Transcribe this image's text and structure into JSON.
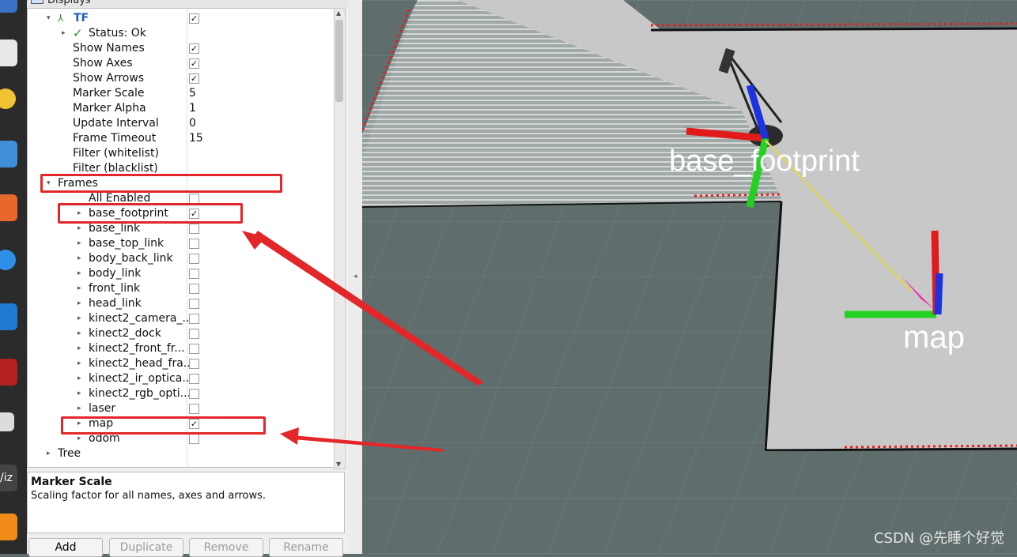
{
  "panel": {
    "title": "Displays",
    "tree": [
      {
        "label": "TF",
        "indent": 1,
        "arrow": "expanded",
        "check": true,
        "bold": true,
        "color": "#1f5fb7",
        "icon": "tf-axes-icon"
      },
      {
        "label": "Status: Ok",
        "indent": 2,
        "arrow": "collapsed",
        "icon": "checkmark-icon"
      },
      {
        "label": "Show Names",
        "indent": 2,
        "check": true
      },
      {
        "label": "Show Axes",
        "indent": 2,
        "check": true
      },
      {
        "label": "Show Arrows",
        "indent": 2,
        "check": true
      },
      {
        "label": "Marker Scale",
        "indent": 2,
        "value": "5"
      },
      {
        "label": "Marker Alpha",
        "indent": 2,
        "value": "1"
      },
      {
        "label": "Update Interval",
        "indent": 2,
        "value": "0"
      },
      {
        "label": "Frame Timeout",
        "indent": 2,
        "value": "15"
      },
      {
        "label": "Filter (whitelist)",
        "indent": 2
      },
      {
        "label": "Filter (blacklist)",
        "indent": 2
      },
      {
        "label": "Frames",
        "indent": 1,
        "arrow": "expanded"
      },
      {
        "label": "All Enabled",
        "indent": 3,
        "check": false
      },
      {
        "label": "base_footprint",
        "indent": 3,
        "arrow": "collapsed",
        "check": true
      },
      {
        "label": "base_link",
        "indent": 3,
        "arrow": "collapsed",
        "check": false
      },
      {
        "label": "base_top_link",
        "indent": 3,
        "arrow": "collapsed",
        "check": false
      },
      {
        "label": "body_back_link",
        "indent": 3,
        "arrow": "collapsed",
        "check": false
      },
      {
        "label": "body_link",
        "indent": 3,
        "arrow": "collapsed",
        "check": false
      },
      {
        "label": "front_link",
        "indent": 3,
        "arrow": "collapsed",
        "check": false
      },
      {
        "label": "head_link",
        "indent": 3,
        "arrow": "collapsed",
        "check": false
      },
      {
        "label": "kinect2_camera_...",
        "indent": 3,
        "arrow": "collapsed",
        "check": false
      },
      {
        "label": "kinect2_dock",
        "indent": 3,
        "arrow": "collapsed",
        "check": false
      },
      {
        "label": "kinect2_front_fr...",
        "indent": 3,
        "arrow": "collapsed",
        "check": false
      },
      {
        "label": "kinect2_head_fra...",
        "indent": 3,
        "arrow": "collapsed",
        "check": false
      },
      {
        "label": "kinect2_ir_optica...",
        "indent": 3,
        "arrow": "collapsed",
        "check": false
      },
      {
        "label": "kinect2_rgb_opti...",
        "indent": 3,
        "arrow": "collapsed",
        "check": false
      },
      {
        "label": "laser",
        "indent": 3,
        "arrow": "collapsed",
        "check": false
      },
      {
        "label": "map",
        "indent": 3,
        "arrow": "collapsed",
        "check": true
      },
      {
        "label": "odom",
        "indent": 3,
        "arrow": "collapsed",
        "check": false
      },
      {
        "label": "Tree",
        "indent": 1,
        "arrow": "collapsed"
      }
    ],
    "info_title": "Marker Scale",
    "info_desc": "Scaling factor for all names, axes and arrows.",
    "buttons": {
      "add": "Add",
      "duplicate": "Duplicate",
      "remove": "Remove",
      "rename": "Rename"
    }
  },
  "viewport": {
    "labels": {
      "base_footprint": "base_footprint",
      "map": "map"
    },
    "colors": {
      "background": "#5f6e6c",
      "map_free": "#c8c8c8",
      "x_axis": "#e01b1b",
      "y_axis": "#22d122",
      "z_axis": "#1b33e0",
      "arrow": "#d9d36a",
      "arrow_head": "#e63cae",
      "laser": "#e32020"
    }
  },
  "dock": {
    "icons": [
      "files-icon",
      "rhythmbox-icon",
      "writer-icon",
      "software-icon",
      "help-icon",
      "vscode-icon",
      "terminal-icon",
      "apps-icon",
      "rviz-icon",
      "vlc-icon"
    ]
  },
  "watermark": "CSDN @先睡个好觉",
  "annotations": {
    "color": "#e3262a"
  }
}
